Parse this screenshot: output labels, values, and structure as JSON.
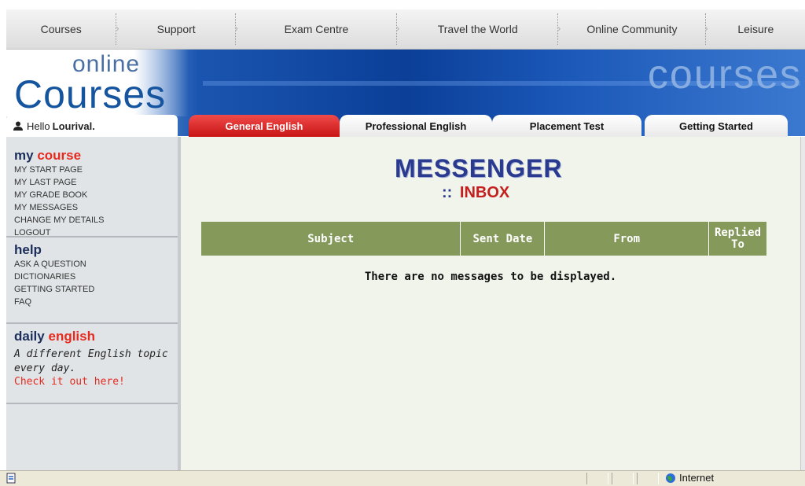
{
  "top_nav": [
    "Courses",
    "Support",
    "Exam Centre",
    "Travel the World",
    "Online Community",
    "Leisure"
  ],
  "banner": {
    "online": "online",
    "courses_logo": "Courses",
    "courses_big": "courses"
  },
  "hello": {
    "prefix": "Hello",
    "name": "Lourival."
  },
  "tabs": [
    "General English",
    "Professional English",
    "Placement Test",
    "Getting Started"
  ],
  "active_tab": "General English",
  "sidebar": {
    "my_course": {
      "title_a": "my",
      "title_b": "course",
      "links": [
        "MY START PAGE",
        "MY LAST PAGE",
        "MY GRADE BOOK",
        "MY MESSAGES",
        "CHANGE MY DETAILS",
        "LOGOUT"
      ]
    },
    "help": {
      "title": "help",
      "links": [
        "ASK A QUESTION",
        "DICTIONARIES",
        "GETTING STARTED",
        "FAQ"
      ]
    },
    "daily": {
      "title_a": "daily",
      "title_b": "english",
      "text": "A different English topic every day.",
      "link": "Check it out here!"
    }
  },
  "main": {
    "title": "MESSENGER",
    "subtitle": "INBOX",
    "subtitle_dots": "::",
    "columns": [
      "Subject",
      "Sent Date",
      "From",
      "Replied To"
    ],
    "empty_message": "There are no messages to be displayed."
  },
  "statusbar": {
    "zone": "Internet"
  },
  "colors": {
    "accent_red": "#e52a1e",
    "table_header": "#84995a",
    "banner_blue": "#0b3f98"
  }
}
